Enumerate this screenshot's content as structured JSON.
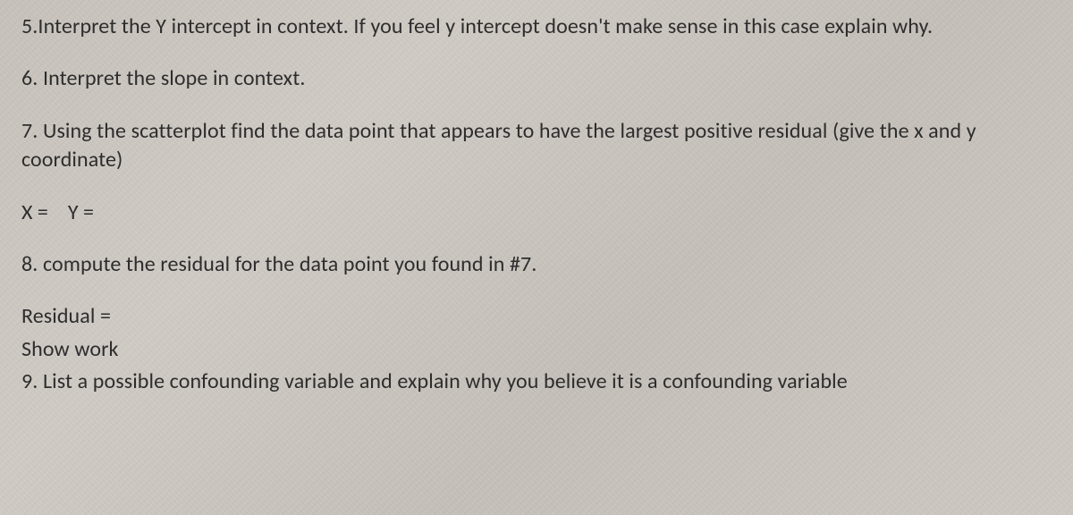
{
  "questions": {
    "q5": "5.Interpret the Y intercept in context.  If you feel y intercept doesn't make sense in this case explain why.",
    "q6": "6. Interpret the slope in context.",
    "q7": "7. Using the scatterplot find the data point that appears to have the largest positive residual (give the x and y coordinate)",
    "q7_answer_x_label": "X =",
    "q7_answer_y_label": "Y =",
    "q8": "8.  compute the residual for the data point you found in #7.",
    "q8_residual_label": "Residual =",
    "q8_show_work": "Show work",
    "q9": "9.  List a possible confounding variable and explain why you believe it is a confounding variable"
  }
}
